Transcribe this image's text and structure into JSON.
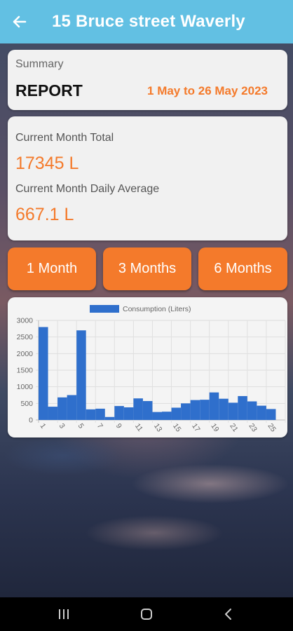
{
  "app_bar": {
    "title": "15 Bruce street Waverly",
    "back_icon": "arrow-left-icon"
  },
  "summary": {
    "label": "Summary",
    "heading": "REPORT",
    "date_range": "1 May to 26 May 2023"
  },
  "totals": {
    "month_total_label": "Current Month Total",
    "month_total_value": "17345 L",
    "daily_average_label": "Current Month Daily Average",
    "daily_average_value": "667.1 L"
  },
  "range_buttons": {
    "one_month": "1 Month",
    "three_months": "3 Months",
    "six_months": "6 Months"
  },
  "colors": {
    "accent": "#f47a2b",
    "app_bar": "#62c0e3",
    "bar_fill": "#2f6fcc"
  },
  "chart_data": {
    "type": "bar",
    "legend": "Consumption (Liters)",
    "legend_position": "top-center",
    "grid": true,
    "ylim": [
      0,
      3000
    ],
    "y_ticks": [
      0,
      500,
      1000,
      1500,
      2000,
      2500,
      3000
    ],
    "x_ticks": [
      "1",
      "3",
      "5",
      "7",
      "9",
      "11",
      "13",
      "15",
      "17",
      "19",
      "21",
      "23",
      "25"
    ],
    "categories": [
      "1",
      "2",
      "3",
      "4",
      "5",
      "6",
      "7",
      "8",
      "9",
      "10",
      "11",
      "12",
      "13",
      "14",
      "15",
      "16",
      "17",
      "18",
      "19",
      "20",
      "21",
      "22",
      "23",
      "24",
      "25",
      "26"
    ],
    "series": [
      {
        "name": "Consumption (Liters)",
        "values": [
          2800,
          400,
          680,
          750,
          2700,
          320,
          340,
          90,
          420,
          380,
          650,
          570,
          240,
          250,
          370,
          500,
          600,
          610,
          830,
          640,
          520,
          720,
          560,
          430,
          330,
          0
        ]
      }
    ]
  },
  "nav_bar": {
    "recents_icon": "recents-icon",
    "home_icon": "home-icon",
    "back_icon": "back-chevron-icon"
  }
}
